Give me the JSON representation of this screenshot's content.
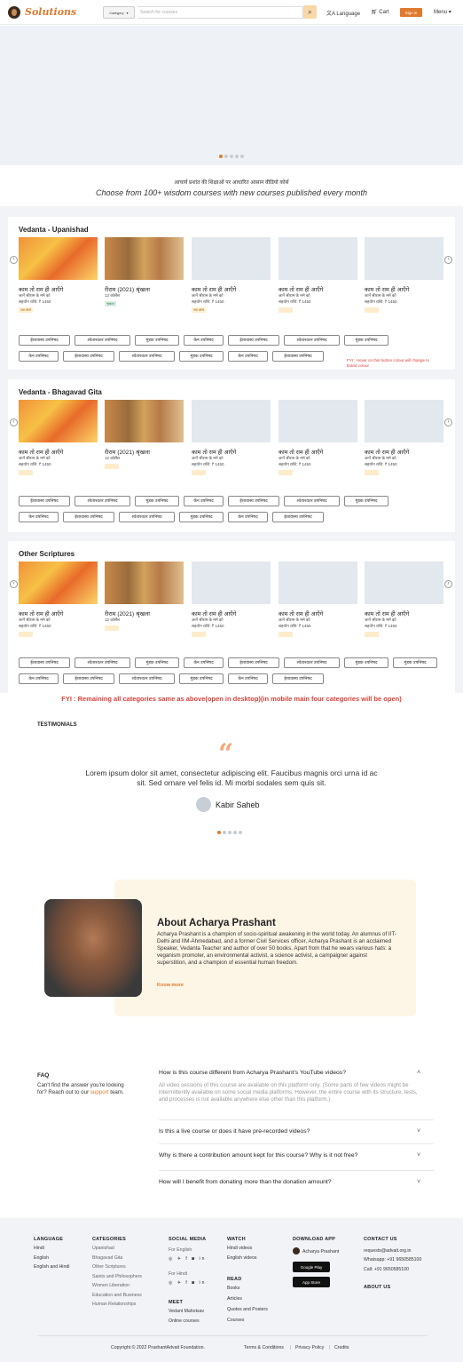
{
  "header": {
    "logo_text": "Solutions",
    "category_label": "Category",
    "search_placeholder": "Search for courses",
    "language_label": "Language",
    "cart_label": "Cart",
    "signin_label": "Sign in",
    "menu_label": "Menu"
  },
  "banner": {
    "slides": 5,
    "active": 0
  },
  "intro": {
    "hindi_tagline": "आचार्य प्रशांत की शिक्षाओं पर आधारित आसान वीडियो कोर्स",
    "tagline": "Choose from 100+ wisdom courses with new courses published every month"
  },
  "sections": [
    {
      "title": "Vedanta - Upanishad",
      "courses": [
        {
          "title": "काम तो राम ही आएँगे",
          "sub1": "जानें श्रीराम के मर्म को",
          "sub2": "सहयोग राशि: ₹ 1450",
          "badge": "नया कोर्स",
          "thumb": "fire"
        },
        {
          "title": "रीराम (2021) श्रृंखला",
          "sub1": "12 कोर्सेस",
          "sub2": "",
          "badge": "शृंखला",
          "thumb": "paint"
        },
        {
          "title": "काम तो राम ही आएँगे",
          "sub1": "जानें श्रीराम के मर्म को",
          "sub2": "सहयोग राशि: ₹ 1450",
          "badge": "नया कोर्स",
          "thumb": "blank"
        },
        {
          "title": "काम तो राम ही आएँगे",
          "sub1": "जानें श्रीराम के मर्म को",
          "sub2": "सहयोग राशि: ₹ 1450",
          "badge": "",
          "thumb": "blank"
        },
        {
          "title": "काम तो राम ही आएँगे",
          "sub1": "जानें श्रीराम के मर्म को",
          "sub2": "सहयोग राशि: ₹ 1450",
          "badge": "",
          "thumb": "blank"
        }
      ],
      "pill_rows": [
        [
          "ईशावास्य उपनिषद",
          "श्वेताश्वतर उपनिषद",
          "मुंडक उपनिषद",
          "केन उपनिषद",
          "ईशावास्य उपनिषद",
          "श्वेताश्वतर उपनिषद",
          "मुंडक उपनिषद"
        ],
        [
          "केन उपनिषद",
          "ईशावास्य उपनिषद",
          "श्वेताश्वतर उपनिषद",
          "मुंडक उपनिषद",
          "केन उपनिषद",
          "ईशावास्य उपनिषद"
        ]
      ],
      "note": "FYI : Hover on this button colour will change to brand colour"
    },
    {
      "title": "Vedanta - Bhagavad Gita",
      "courses": [
        {
          "title": "काम तो राम ही आएँगे",
          "sub1": "जानें श्रीराम के मर्म को",
          "sub2": "सहयोग राशि: ₹ 1450",
          "badge": "",
          "thumb": "fire"
        },
        {
          "title": "रीराम (2021) श्रृंखला",
          "sub1": "12 कोर्सेस",
          "sub2": "",
          "badge": "",
          "thumb": "paint"
        },
        {
          "title": "काम तो राम ही आएँगे",
          "sub1": "जानें श्रीराम के मर्म को",
          "sub2": "सहयोग राशि: ₹ 1450",
          "badge": "",
          "thumb": "blank"
        },
        {
          "title": "काम तो राम ही आएँगे",
          "sub1": "जानें श्रीराम के मर्म को",
          "sub2": "सहयोग राशि: ₹ 1450",
          "badge": "",
          "thumb": "blank"
        },
        {
          "title": "काम तो राम ही आएँगे",
          "sub1": "जानें श्रीराम के मर्म को",
          "sub2": "सहयोग राशि: ₹ 1450",
          "badge": "",
          "thumb": "blank"
        }
      ],
      "pill_rows": [
        [
          "ईशावास्य उपनिषद",
          "श्वेताश्वतर उपनिषद",
          "मुंडक उपनिषद",
          "केन उपनिषद",
          "ईशावास्य उपनिषद",
          "श्वेताश्वतर उपनिषद",
          "मुंडक उपनिषद"
        ],
        [
          "केन उपनिषद",
          "ईशावास्य उपनिषद",
          "श्वेताश्वतर उपनिषद",
          "मुंडक उपनिषद",
          "केन उपनिषद",
          "ईशावास्य उपनिषद"
        ]
      ]
    },
    {
      "title": "Other Scriptures",
      "courses": [
        {
          "title": "काम तो राम ही आएँगे",
          "sub1": "जानें श्रीराम के मर्म को",
          "sub2": "सहयोग राशि: ₹ 1450",
          "badge": "",
          "thumb": "fire"
        },
        {
          "title": "रीराम (2021) श्रृंखला",
          "sub1": "12 कोर्सेस",
          "sub2": "",
          "badge": "",
          "thumb": "paint"
        },
        {
          "title": "काम तो राम ही आएँगे",
          "sub1": "जानें श्रीराम के मर्म को",
          "sub2": "सहयोग राशि: ₹ 1450",
          "badge": "",
          "thumb": "blank"
        },
        {
          "title": "काम तो राम ही आएँगे",
          "sub1": "जानें श्रीराम के मर्म को",
          "sub2": "सहयोग राशि: ₹ 1450",
          "badge": "",
          "thumb": "blank"
        },
        {
          "title": "काम तो राम ही आएँगे",
          "sub1": "जानें श्रीराम के मर्म को",
          "sub2": "सहयोग राशि: ₹ 1450",
          "badge": "",
          "thumb": "blank"
        }
      ],
      "pill_rows": [
        [
          "ईशावास्य उपनिषद",
          "श्वेताश्वतर उपनिषद",
          "मुंडक उपनिषद",
          "केन उपनिषद",
          "ईशावास्य उपनिषद",
          "श्वेताश्वतर उपनिषद",
          "मुंडक उपनिषद",
          "मुंडक उपनिषद"
        ],
        [
          "केन उपनिषद",
          "ईशावास्य उपनिषद",
          "श्वेताश्वतर उपनिषद",
          "मुंडक उपनिषद",
          "केन उपनिषद",
          "ईशावास्य उपनिषद"
        ]
      ]
    }
  ],
  "fyi_categories": "FYI : Remaining all categories same as above(open in desktop)(in mobile main four categories will be open)",
  "testimonials": {
    "heading": "TESTIMONIALS",
    "quote_mark": "“",
    "text": "Lorem ipsum dolor sit amet, consectetur adipiscing elit. Faucibus magnis orci urna id ac sit. Sed ornare vel felis id. Mi morbi sodales sem quis sit.",
    "name": "Kabir Saheb",
    "slides": 5,
    "active": 0
  },
  "about": {
    "heading": "About Acharya Prashant",
    "text": "Acharya Prashant is a champion of socio-spiritual awakening in the world today. An alumnus of IIT-Delhi and IIM-Ahmedabad, and a former Civil Services officer, Acharya Prashant is an acclaimed Speaker, Vedanta Teacher and author of over 50 books. Apart from that he wears various hats: a veganism promoter, an environmental activist, a science activist, a campaigner against superstition, and a champion of essential human freedom.",
    "link": "Know more"
  },
  "faq": {
    "heading": "FAQ",
    "intro_before": "Can't find the answer you're looking for? Reach out to our",
    "intro_link": "support",
    "intro_after": "team.",
    "items": [
      {
        "q": "How is this course different from Acharya Prashant's YouTube videos?",
        "a": "All video sessions of this course are available on this platform only. (Some parts of few videos might be intermittently available on some social media platforms. However, the entire course with its structure, tests, and processes is not available anywhere else other than this platform.)",
        "open": true
      },
      {
        "q": "Is this a live course or does it have pre-recorded videos?",
        "a": "",
        "open": false
      },
      {
        "q": "Why is there a contribution amount kept for this course? Why is it not free?",
        "a": "",
        "open": false
      },
      {
        "q": "How will I benefit from donating more than the donation amount?",
        "a": "",
        "open": false
      }
    ]
  },
  "footer": {
    "language": {
      "heading": "LANGUAGE",
      "items": [
        "Hindi",
        "English",
        "English and Hindi"
      ]
    },
    "categories": {
      "heading": "CATEGORIES",
      "items": [
        "Upanishad",
        "Bhagavad Gita",
        "Other Scriptures",
        "Saints and Philosophers",
        "Women Liberation",
        "Education and Business",
        "Human Relationships"
      ]
    },
    "social": {
      "heading": "SOCIAL MEDIA",
      "english_label": "For English",
      "hindi_label": "For Hindi",
      "icons": "◎ ✈ f ◙ in"
    },
    "meet": {
      "heading": "MEET",
      "items": [
        "Vedant Mahotsav",
        "Online courses"
      ]
    },
    "watch": {
      "heading": "WATCH",
      "items": [
        "Hindi videos",
        "English videos"
      ]
    },
    "read": {
      "heading": "READ",
      "items": [
        "Books",
        "Articles",
        "Quotes and Posters",
        "Courses"
      ]
    },
    "app": {
      "heading": "DOWNLOAD APP",
      "app_name": "Acharya Prashant",
      "google_play": "Google Play",
      "app_store": "App Store"
    },
    "contact": {
      "heading": "CONTACT US",
      "email": "requests@advait.org.in",
      "whatsapp": "Whatsapp: +91 9650585100",
      "call": "Call: +91 9650585100",
      "about": "ABOUT US"
    },
    "copyright": "Copyright © 2022 PrashantAdvait Foundation.",
    "terms": "Terms & Conditions",
    "privacy": "Privacy Policy",
    "credits": "Credits"
  }
}
